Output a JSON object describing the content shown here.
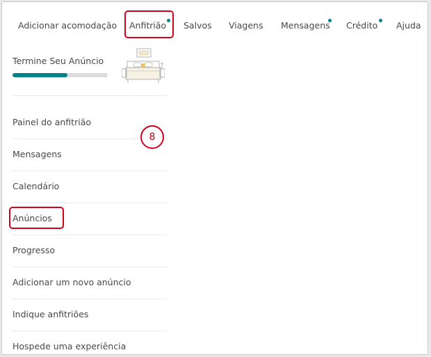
{
  "topnav": {
    "items": [
      {
        "label": "Adicionar acomodação",
        "has_dot": false
      },
      {
        "label": "Anfitrião",
        "has_dot": true
      },
      {
        "label": "Salvos",
        "has_dot": false
      },
      {
        "label": "Viagens",
        "has_dot": false
      },
      {
        "label": "Mensagens",
        "has_dot": true
      },
      {
        "label": "Crédito",
        "has_dot": true
      },
      {
        "label": "Ajuda",
        "has_dot": false
      }
    ],
    "highlighted_item": "Anfitrião"
  },
  "listing_progress": {
    "title": "Termine Seu Anúncio",
    "progress_fraction": 0.58,
    "illustration": "bed-illustration"
  },
  "sidebar": {
    "items": [
      {
        "label": "Painel do anfitrião"
      },
      {
        "label": "Mensagens"
      },
      {
        "label": "Calendário"
      },
      {
        "label": "Anúncios"
      },
      {
        "label": "Progresso"
      },
      {
        "label": "Adicionar um novo anúncio"
      },
      {
        "label": "Indique anfitriões"
      },
      {
        "label": "Hospede uma experiência"
      }
    ],
    "highlighted_item": "Anúncios"
  },
  "step_badge": {
    "number": "8"
  },
  "colors": {
    "accent_teal": "#008489",
    "callout_red": "#d0021b",
    "text": "#484848",
    "divider": "#ebebeb"
  }
}
